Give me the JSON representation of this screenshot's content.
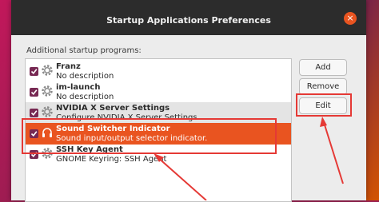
{
  "window": {
    "title": "Startup Applications Preferences",
    "close_icon": "×"
  },
  "section_label": "Additional startup programs:",
  "programs": [
    {
      "name": "Franz",
      "description": "No description",
      "enabled": true,
      "icon": "gear-icon"
    },
    {
      "name": "im-launch",
      "description": "No description",
      "enabled": true,
      "icon": "gear-icon"
    },
    {
      "name": "NVIDIA X Server Settings",
      "description": "Configure NVIDIA X Server Settings",
      "enabled": true,
      "icon": "gear-icon"
    },
    {
      "name": "Sound Switcher Indicator",
      "description": "Sound input/output selector indicator.",
      "enabled": true,
      "icon": "headphones-icon",
      "selected": true
    },
    {
      "name": "SSH Key Agent",
      "description": "GNOME Keyring: SSH Agent",
      "enabled": true,
      "icon": "gear-icon"
    }
  ],
  "buttons": {
    "add": "Add",
    "remove": "Remove",
    "edit": "Edit"
  },
  "colors": {
    "selection": "#e95420",
    "checkbox": "#772953",
    "annotation": "#e53935"
  }
}
